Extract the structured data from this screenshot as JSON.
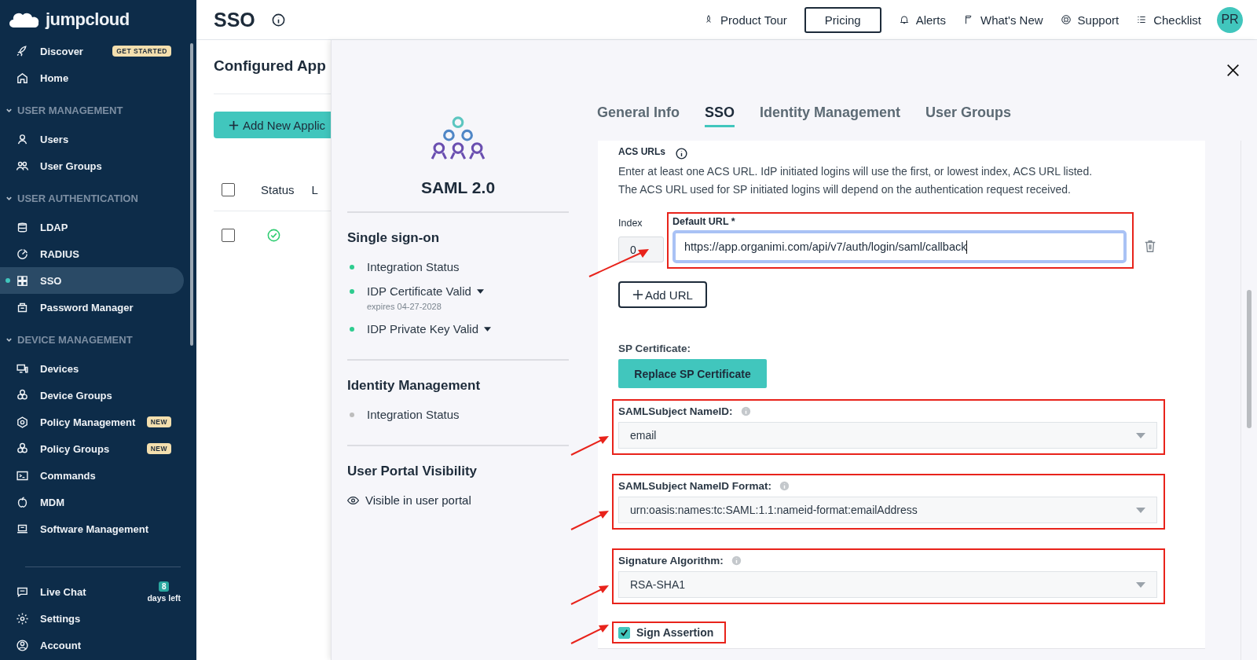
{
  "sidebar": {
    "logo": "jumpcloud",
    "top_items": [
      {
        "label": "Discover",
        "selected": false,
        "badge": "GET STARTED"
      },
      {
        "label": "Home",
        "selected": false
      }
    ],
    "sections": [
      {
        "heading": "USER MANAGEMENT",
        "expanded": true,
        "items": [
          {
            "label": "Users",
            "selected": false
          },
          {
            "label": "User Groups",
            "selected": false
          }
        ]
      },
      {
        "heading": "USER AUTHENTICATION",
        "expanded": true,
        "items": [
          {
            "label": "LDAP",
            "selected": false
          },
          {
            "label": "RADIUS",
            "selected": false
          },
          {
            "label": "SSO",
            "selected": true
          },
          {
            "label": "Password Manager",
            "selected": false
          }
        ]
      },
      {
        "heading": "DEVICE MANAGEMENT",
        "expanded": true,
        "items": [
          {
            "label": "Devices",
            "selected": false
          },
          {
            "label": "Device Groups",
            "selected": false
          },
          {
            "label": "Policy Management",
            "selected": false,
            "badge": "NEW"
          },
          {
            "label": "Policy Groups",
            "selected": false,
            "badge": "NEW"
          },
          {
            "label": "Commands",
            "selected": false
          },
          {
            "label": "MDM",
            "selected": false
          },
          {
            "label": "Software Management",
            "selected": false
          }
        ]
      }
    ],
    "footer_items": [
      {
        "label": "Live Chat",
        "selected": false,
        "trial": {
          "count": "8",
          "text": "days left"
        }
      },
      {
        "label": "Settings",
        "selected": false
      },
      {
        "label": "Account",
        "selected": false
      }
    ]
  },
  "topbar": {
    "title": "SSO",
    "nav": [
      {
        "kind": "link",
        "label": "Product Tour"
      },
      {
        "kind": "button",
        "label": "Pricing"
      },
      {
        "kind": "link",
        "label": "Alerts"
      },
      {
        "kind": "link",
        "label": "What's New"
      },
      {
        "kind": "link",
        "label": "Support"
      },
      {
        "kind": "link",
        "label": "Checklist"
      }
    ],
    "avatar": "PR"
  },
  "background_page": {
    "title": "Configured App",
    "add_button": "Add New Applic",
    "columns": [
      "Status",
      "L"
    ],
    "rows": [
      {
        "checked": false,
        "status_ok": true
      }
    ],
    "header_checked": false
  },
  "modal": {
    "app_name": "SAML 2.0",
    "sections": [
      {
        "title": "Single sign-on",
        "items": [
          {
            "label": "Integration Status",
            "color": "#2ecc8f",
            "expandable": false
          },
          {
            "label": "IDP Certificate Valid",
            "color": "#2ecc8f",
            "expandable": true,
            "note": "expires 04-27-2028"
          },
          {
            "label": "IDP Private Key Valid",
            "color": "#2ecc8f",
            "expandable": true
          }
        ]
      },
      {
        "title": "Identity Management",
        "items": [
          {
            "label": "Integration Status",
            "color": "#bdbdbd",
            "expandable": false
          }
        ]
      },
      {
        "title": "User Portal Visibility",
        "visibility": "Visible in user portal"
      }
    ],
    "tabs": [
      {
        "label": "General Info",
        "selected": false
      },
      {
        "label": "SSO",
        "selected": true
      },
      {
        "label": "Identity Management",
        "selected": false
      },
      {
        "label": "User Groups",
        "selected": false
      }
    ],
    "form": {
      "acs_label": "ACS URLs",
      "description": [
        "Enter at least one ACS URL. IdP initiated logins will use the first, or lowest index, ACS URL listed.",
        "The ACS URL used for SP initiated logins will depend on the authentication request received."
      ],
      "index_label": "Index",
      "index_value": "0",
      "url_label": "Default URL *",
      "url_value": "https://app.organimi.com/api/v7/auth/login/saml/callback",
      "url_focused": true,
      "url_highlighted": true,
      "add_url": "Add URL",
      "sp_cert_label": "SP Certificate:",
      "sp_cert_button": "Replace SP Certificate",
      "selects": [
        {
          "label": "SAMLSubject NameID:",
          "value": "email",
          "highlighted": true
        },
        {
          "label": "SAMLSubject NameID Format:",
          "value": "urn:oasis:names:tc:SAML:1.1:nameid-format:emailAddress",
          "highlighted": true
        },
        {
          "label": "Signature Algorithm:",
          "value": "RSA-SHA1",
          "highlighted": true
        }
      ],
      "sign_assertion": {
        "label": "Sign Assertion",
        "checked": true,
        "highlighted": true
      }
    }
  }
}
